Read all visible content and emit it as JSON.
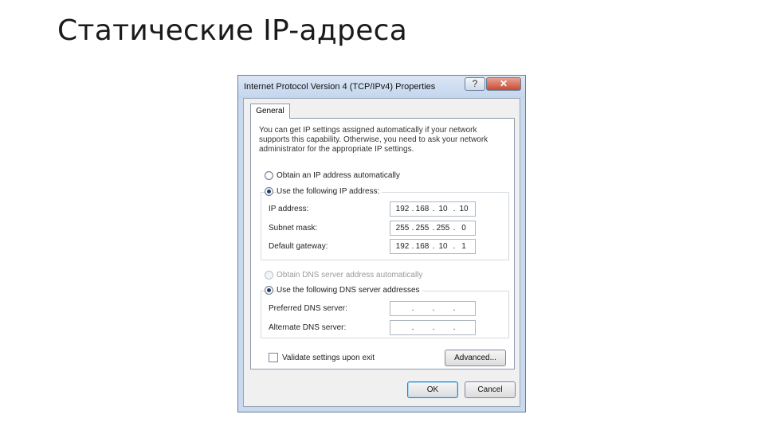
{
  "slide": {
    "title": "Статические IP-адреса"
  },
  "dialog": {
    "title": "Internet Protocol Version 4 (TCP/IPv4) Properties",
    "help_label": "?",
    "close_label": "✕",
    "tab_label": "General",
    "description": "You can get IP settings assigned automatically if your network supports this capability. Otherwise, you need to ask your network administrator for the appropriate IP settings.",
    "ip_section": {
      "auto_label": "Obtain an IP address automatically",
      "manual_label": "Use the following IP address:",
      "selected": "manual",
      "fields": [
        {
          "label": "IP address:",
          "octets": [
            "192",
            "168",
            "10",
            "10"
          ]
        },
        {
          "label": "Subnet mask:",
          "octets": [
            "255",
            "255",
            "255",
            "0"
          ]
        },
        {
          "label": "Default gateway:",
          "octets": [
            "192",
            "168",
            "10",
            "1"
          ]
        }
      ]
    },
    "dns_section": {
      "auto_label": "Obtain DNS server address automatically",
      "manual_label": "Use the following DNS server addresses",
      "selected": "manual",
      "fields": [
        {
          "label": "Preferred DNS server:",
          "octets": [
            "",
            "",
            "",
            ""
          ]
        },
        {
          "label": "Alternate DNS server:",
          "octets": [
            "",
            "",
            "",
            ""
          ]
        }
      ]
    },
    "validate_label": "Validate settings upon exit",
    "validate_checked": false,
    "advanced_label": "Advanced...",
    "ok_label": "OK",
    "cancel_label": "Cancel"
  }
}
